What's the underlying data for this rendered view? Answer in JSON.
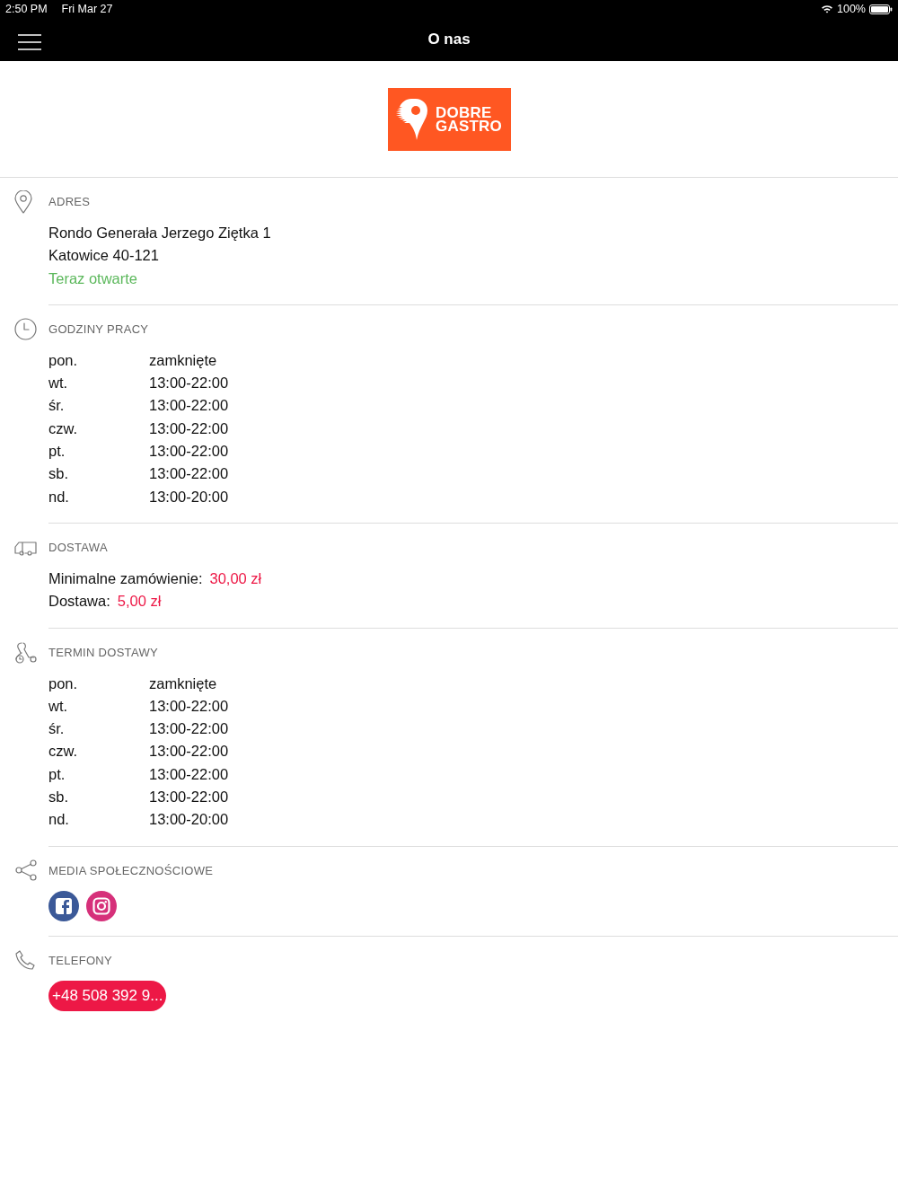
{
  "status_bar": {
    "time": "2:50 PM",
    "date": "Fri Mar 27",
    "battery": "100%"
  },
  "nav": {
    "title": "O nas"
  },
  "logo": {
    "line1": "DOBRE",
    "line2": "GASTRO"
  },
  "sections": [
    {
      "kind": "address",
      "title": "ADRES",
      "lines": [
        "Rondo Generała Jerzego Ziętka 1",
        "Katowice 40-121"
      ],
      "status": "Teraz otwarte"
    },
    {
      "kind": "hours",
      "title": "GODZINY PRACY",
      "rows": [
        {
          "day": "pon.",
          "time": "zamknięte"
        },
        {
          "day": "wt.",
          "time": "13:00-22:00"
        },
        {
          "day": "śr.",
          "time": "13:00-22:00"
        },
        {
          "day": "czw.",
          "time": "13:00-22:00"
        },
        {
          "day": "pt.",
          "time": "13:00-22:00"
        },
        {
          "day": "sb.",
          "time": "13:00-22:00"
        },
        {
          "day": "nd.",
          "time": "13:00-20:00"
        }
      ]
    },
    {
      "kind": "delivery",
      "title": "DOSTAWA",
      "items": [
        {
          "label": "Minimalne zamówienie:",
          "value": "30,00 zł"
        },
        {
          "label": "Dostawa:",
          "value": "5,00 zł"
        }
      ]
    },
    {
      "kind": "hours",
      "title": "TERMIN DOSTAWY",
      "rows": [
        {
          "day": "pon.",
          "time": "zamknięte"
        },
        {
          "day": "wt.",
          "time": "13:00-22:00"
        },
        {
          "day": "śr.",
          "time": "13:00-22:00"
        },
        {
          "day": "czw.",
          "time": "13:00-22:00"
        },
        {
          "day": "pt.",
          "time": "13:00-22:00"
        },
        {
          "day": "sb.",
          "time": "13:00-22:00"
        },
        {
          "day": "nd.",
          "time": "13:00-20:00"
        }
      ]
    },
    {
      "kind": "social",
      "title": "MEDIA SPOŁECZNOŚCIOWE",
      "links": [
        {
          "kind": "facebook"
        },
        {
          "kind": "instagram"
        }
      ]
    },
    {
      "kind": "phones",
      "title": "TELEFONY",
      "numbers": [
        "+48 508 392 9..."
      ]
    }
  ]
}
